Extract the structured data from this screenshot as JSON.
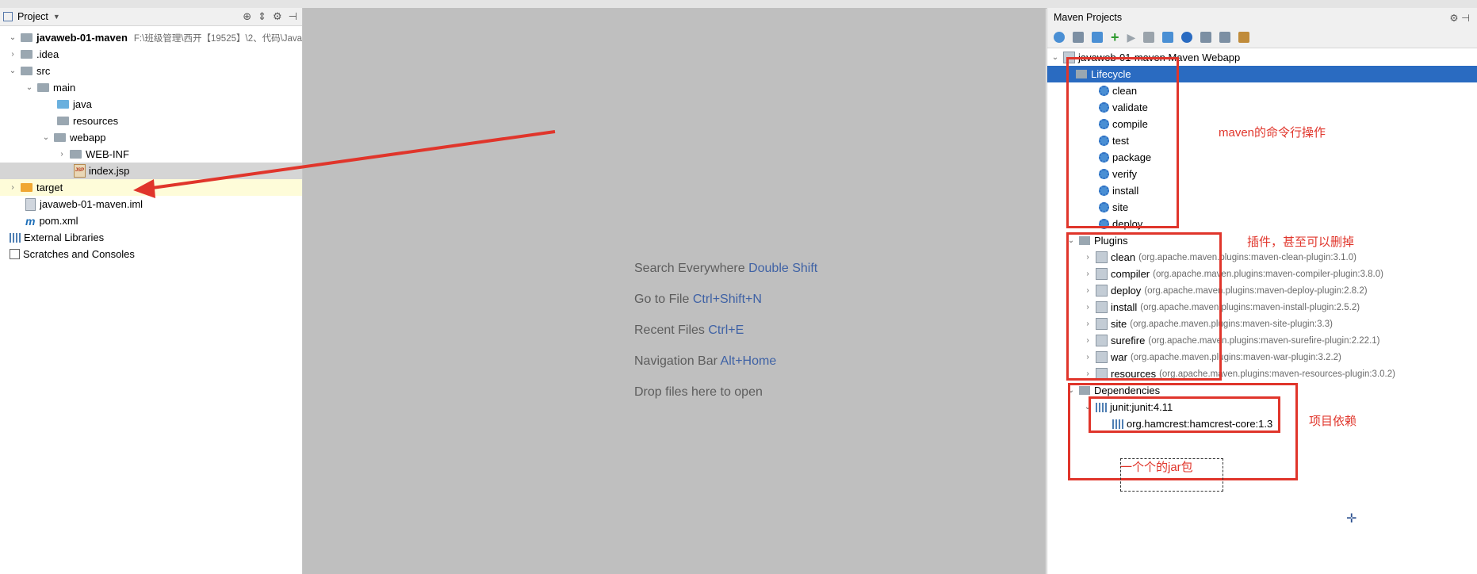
{
  "project_panel": {
    "title": "Project",
    "tree": [
      {
        "label": "javaweb-01-maven",
        "path": "F:\\班级管理\\西开【19525】\\2、代码\\Java"
      },
      {
        "label": ".idea"
      },
      {
        "label": "src"
      },
      {
        "label": "main"
      },
      {
        "label": "java"
      },
      {
        "label": "resources"
      },
      {
        "label": "webapp"
      },
      {
        "label": "WEB-INF"
      },
      {
        "label": "index.jsp",
        "icon_text": "JSP"
      },
      {
        "label": "target"
      },
      {
        "label": "javaweb-01-maven.iml"
      },
      {
        "label": "pom.xml",
        "icon_text": "m"
      },
      {
        "label": "External Libraries"
      },
      {
        "label": "Scratches and Consoles"
      }
    ]
  },
  "editor": {
    "hints": [
      {
        "text": "Search Everywhere",
        "key": "Double Shift"
      },
      {
        "text": "Go to File",
        "key": "Ctrl+Shift+N"
      },
      {
        "text": "Recent Files",
        "key": "Ctrl+E"
      },
      {
        "text": "Navigation Bar",
        "key": "Alt+Home"
      },
      {
        "text": "Drop files here to open",
        "key": ""
      }
    ]
  },
  "maven_panel": {
    "title": "Maven Projects",
    "root": "javaweb-01-maven Maven Webapp",
    "lifecycle_label": "Lifecycle",
    "lifecycle": [
      "clean",
      "validate",
      "compile",
      "test",
      "package",
      "verify",
      "install",
      "site",
      "deploy"
    ],
    "plugins_label": "Plugins",
    "plugins": [
      {
        "name": "clean",
        "coord": "(org.apache.maven.plugins:maven-clean-plugin:3.1.0)"
      },
      {
        "name": "compiler",
        "coord": "(org.apache.maven.plugins:maven-compiler-plugin:3.8.0)"
      },
      {
        "name": "deploy",
        "coord": "(org.apache.maven.plugins:maven-deploy-plugin:2.8.2)"
      },
      {
        "name": "install",
        "coord": "(org.apache.maven.plugins:maven-install-plugin:2.5.2)"
      },
      {
        "name": "site",
        "coord": "(org.apache.maven.plugins:maven-site-plugin:3.3)"
      },
      {
        "name": "surefire",
        "coord": "(org.apache.maven.plugins:maven-surefire-plugin:2.22.1)"
      },
      {
        "name": "war",
        "coord": "(org.apache.maven.plugins:maven-war-plugin:3.2.2)"
      },
      {
        "name": "resources",
        "coord": "(org.apache.maven.plugins:maven-resources-plugin:3.0.2)"
      }
    ],
    "dependencies_label": "Dependencies",
    "dependencies": [
      "junit:junit:4.11",
      "org.hamcrest:hamcrest-core:1.3"
    ]
  },
  "annotations": {
    "lifecycle_note": "maven的命令行操作",
    "plugins_note": "插件，甚至可以删掉",
    "deps_note": "项目依赖",
    "jar_note": "一个个的jar包"
  },
  "colors": {
    "annotation": "#e0352b",
    "selection": "#2a6bc1",
    "key_hint": "#3f62a5"
  }
}
